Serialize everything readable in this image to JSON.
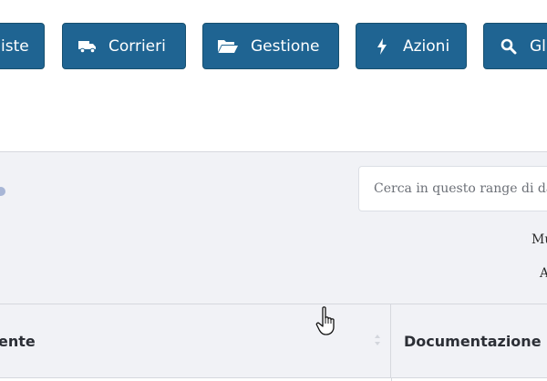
{
  "toolbar": {
    "buttons": [
      {
        "label": "iste",
        "icon": "none"
      },
      {
        "label": "Corrieri",
        "icon": "truck-icon"
      },
      {
        "label": "Gestione",
        "icon": "folder-open-icon"
      },
      {
        "label": "Azioni",
        "icon": "bolt-icon"
      },
      {
        "label": "Gl",
        "icon": "search-icon"
      }
    ],
    "button_color": "#1f6492"
  },
  "filters": {
    "search_placeholder": "Cerca in questo range di date",
    "label_mu": "Mu",
    "label_a": "A"
  },
  "table": {
    "columns": [
      {
        "label": "ente"
      },
      {
        "label": "Documentazione"
      }
    ]
  },
  "colors": {
    "panel_bg": "#f1f2f6",
    "border": "#d6d8de",
    "header_text": "#2c2f36"
  }
}
